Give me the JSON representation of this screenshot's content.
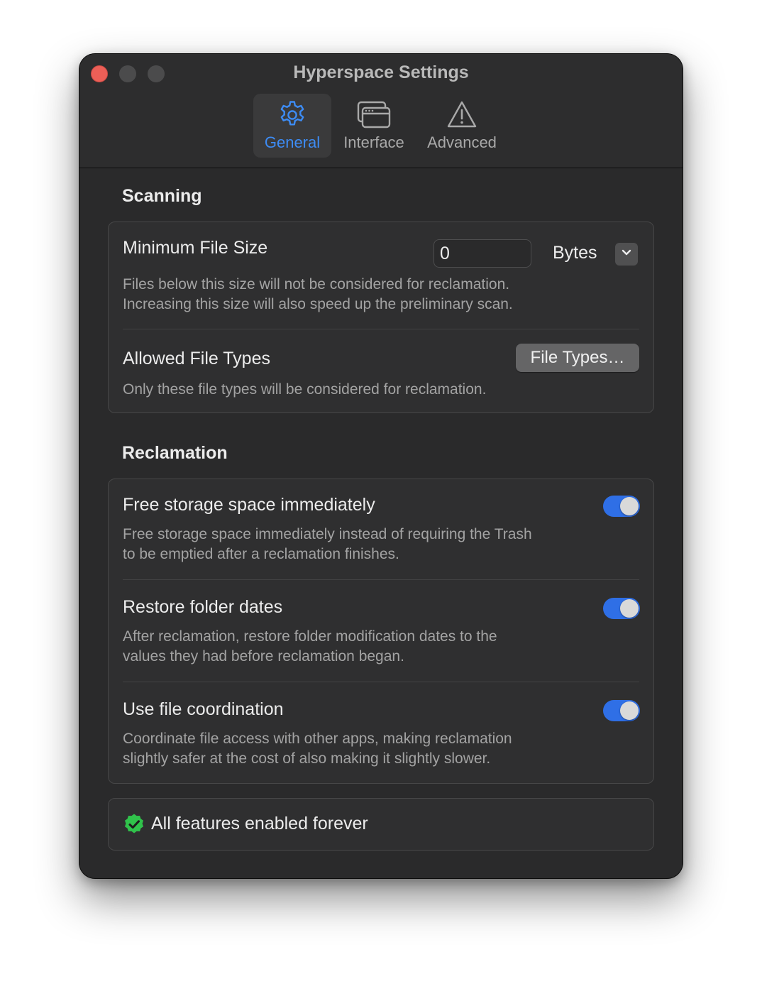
{
  "window": {
    "title": "Hyperspace Settings"
  },
  "colors": {
    "accent": "#3d8cf5",
    "toggle_on": "#2f6fe6",
    "close_button": "#ec5f57",
    "badge_green": "#30c24b"
  },
  "tabs": [
    {
      "label": "General",
      "icon": "gear-icon",
      "selected": true
    },
    {
      "label": "Interface",
      "icon": "windows-icon",
      "selected": false
    },
    {
      "label": "Advanced",
      "icon": "warning-icon",
      "selected": false
    }
  ],
  "scanning": {
    "title": "Scanning",
    "min_size": {
      "title": "Minimum File Size",
      "value": "0",
      "unit": "Bytes",
      "description": "Files below this size will not be considered for reclamation.\nIncreasing this size will also speed up the preliminary scan."
    },
    "file_types": {
      "title": "Allowed File Types",
      "button": "File Types…",
      "description": "Only these file types will be considered for reclamation."
    }
  },
  "reclamation": {
    "title": "Reclamation",
    "items": [
      {
        "title": "Free storage space immediately",
        "description": "Free storage space immediately instead of requiring the Trash\nto be emptied after a reclamation finishes.",
        "enabled": true
      },
      {
        "title": "Restore folder dates",
        "description": "After reclamation, restore folder modification dates to the\nvalues they had before reclamation began.",
        "enabled": true
      },
      {
        "title": "Use file coordination",
        "description": "Coordinate file access with other apps, making reclamation\nslightly safer at the cost of also making it slightly slower.",
        "enabled": true
      }
    ]
  },
  "license": {
    "status": "All features enabled forever",
    "icon": "checkmark-seal-icon"
  }
}
